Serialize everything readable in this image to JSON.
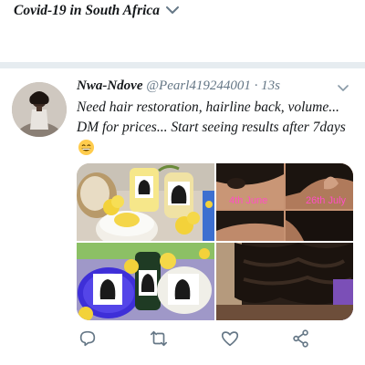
{
  "topic": {
    "title": "Covid-19 in South Africa",
    "chevron_icon": "chevron-down-icon"
  },
  "tweet": {
    "display_name": "Nwa-Ndove",
    "handle": "@Pearl419244001",
    "separator": "·",
    "timestamp": "13s",
    "text": "Need hair restoration, hairline back, volume... DM for prices... Start seeing results after 7days",
    "emoji": "grinning-face-with-smiling-eyes",
    "media": [
      {
        "name": "hair-products-flowers-photo",
        "labels": []
      },
      {
        "name": "hairline-before-after-photo",
        "labels": [
          "4th June",
          "26th July"
        ]
      },
      {
        "name": "hair-products-purple-photo",
        "labels": []
      },
      {
        "name": "hair-volume-photo",
        "labels": []
      }
    ],
    "actions": [
      "reply-icon",
      "retweet-icon",
      "like-icon",
      "share-icon"
    ],
    "colors": {
      "text": "#14171a",
      "secondary": "#657786",
      "icon": "#657786",
      "divider": "#e6ecf0"
    }
  }
}
